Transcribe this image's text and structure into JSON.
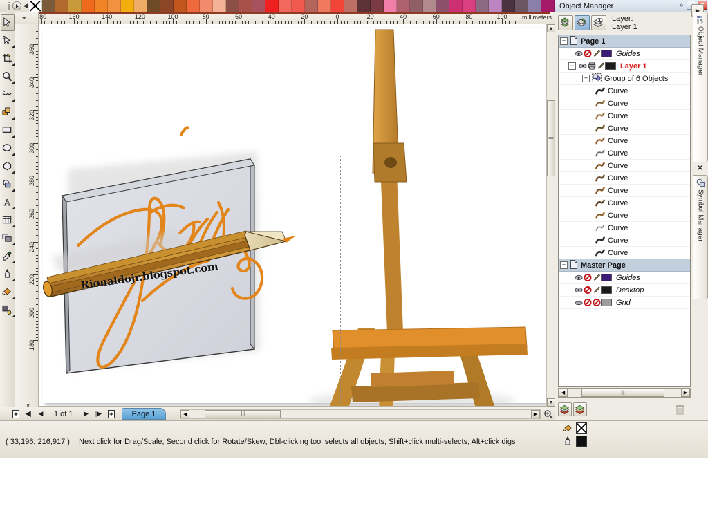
{
  "app": {
    "palette": {
      "name": "color-palette",
      "no_color_label": "No Color",
      "swatches": [
        "#7a5c3a",
        "#b06a2c",
        "#c89a3a",
        "#ef6a1d",
        "#f08325",
        "#f2913f",
        "#f4ad0e",
        "#eeac67",
        "#6e4a26",
        "#8c4526",
        "#c2571d",
        "#ee6a3c",
        "#f08b6c",
        "#f3b195",
        "#8a4f47",
        "#a8504a",
        "#a8525f",
        "#ef2020",
        "#f2685c",
        "#f05a4f",
        "#b3665c",
        "#f07a5e",
        "#f2453a",
        "#bc7065",
        "#5d3237",
        "#7b3b45",
        "#ef7fa8",
        "#b0616f",
        "#8e6066",
        "#b08a8c",
        "#8c4f6c",
        "#cc2f72",
        "#d8407f",
        "#8c6a84",
        "#bd84c2",
        "#4a3240",
        "#6b5663",
        "#8a7fa8",
        "#a61a6a",
        "#8e5a7e",
        "#7a5390",
        "#6d4f86"
      ],
      "current_color": "#101010"
    },
    "toolbox": [
      {
        "name": "pick-tool",
        "label": "Pick",
        "active": true,
        "flyout": false
      },
      {
        "name": "shape-tool",
        "label": "Shape",
        "active": false,
        "flyout": true
      },
      {
        "name": "crop-tool",
        "label": "Crop",
        "active": false,
        "flyout": true
      },
      {
        "name": "zoom-tool",
        "label": "Zoom",
        "active": false,
        "flyout": true
      },
      {
        "name": "freehand-tool",
        "label": "Freehand",
        "active": false,
        "flyout": true
      },
      {
        "name": "smart-fill-tool",
        "label": "Smart Fill",
        "active": false,
        "flyout": true
      },
      {
        "name": "rectangle-tool",
        "label": "Rectangle",
        "active": false,
        "flyout": true
      },
      {
        "name": "ellipse-tool",
        "label": "Ellipse",
        "active": false,
        "flyout": true
      },
      {
        "name": "polygon-tool",
        "label": "Polygon",
        "active": false,
        "flyout": true
      },
      {
        "name": "basic-shapes-tool",
        "label": "Basic Shapes",
        "active": false,
        "flyout": true
      },
      {
        "name": "text-tool",
        "label": "Text",
        "active": false,
        "flyout": true
      },
      {
        "name": "table-tool",
        "label": "Table",
        "active": false,
        "flyout": true
      },
      {
        "name": "blend-tool",
        "label": "Blend",
        "active": false,
        "flyout": true
      },
      {
        "name": "eyedropper-tool",
        "label": "Color Eyedropper",
        "active": false,
        "flyout": true
      },
      {
        "name": "outline-tool",
        "label": "Outline",
        "active": false,
        "flyout": true
      },
      {
        "name": "fill-tool",
        "label": "Fill",
        "active": false,
        "flyout": true
      },
      {
        "name": "interactive-fill-tool",
        "label": "Interactive Fill",
        "active": false,
        "flyout": true
      }
    ],
    "rulers": {
      "unit_label": "millimeters",
      "horizontal_ticks": [
        140,
        120,
        100,
        80,
        60,
        40,
        20,
        0,
        20,
        40,
        60,
        80
      ],
      "vertical_ticks": [
        360,
        340,
        320,
        300,
        280,
        260,
        240,
        220,
        200
      ]
    },
    "canvas": {
      "watermark": "Rionaldojr.blogspot.com",
      "artwork_description": "easel-with-canvas-and-pencil"
    },
    "pagenav": {
      "add_page_before_label": "+",
      "first_label": "◀|",
      "prev_label": "◀",
      "counter": "1 of 1",
      "next_label": "▶",
      "last_label": "|▶",
      "add_page_after_label": "+",
      "tab_label": "Page 1"
    },
    "docker": {
      "title": "Object Manager",
      "chevron_label": "»",
      "minimize_label": "–",
      "close_label": "✕",
      "layer_caption_line1": "Layer:",
      "layer_caption_line2": "Layer 1",
      "buttons": [
        {
          "name": "show-object-properties-button",
          "label": "Show Object Properties",
          "on": false
        },
        {
          "name": "edit-across-layers-button",
          "label": "Edit Across Layers",
          "on": true
        },
        {
          "name": "layer-manager-view-button",
          "label": "Layer Manager View",
          "on": false
        }
      ],
      "options_label": "▶",
      "tree": [
        {
          "name": "page-1-row",
          "label": "Page 1",
          "type": "header",
          "expander": "−",
          "indent": 2,
          "icon": "page-icon",
          "style": "bold"
        },
        {
          "name": "guides-row",
          "label": "Guides",
          "type": "item",
          "indent": 22,
          "icon": "eye-printer-pencil",
          "color": "#3c1c78",
          "style": "italic",
          "locked": true
        },
        {
          "name": "layer-1-row",
          "label": "Layer 1",
          "type": "item",
          "expander": "−",
          "indent": 14,
          "icon": "eye-printer-pencil",
          "color": "#1b1b1b",
          "style": "red"
        },
        {
          "name": "group-row",
          "label": "Group of 6 Objects",
          "type": "group",
          "expander": "+",
          "indent": 34,
          "icon": "group-icon"
        },
        {
          "name": "curve-row",
          "label": "Curve",
          "type": "curve",
          "indent": 52,
          "icon_color": "#2b2b2b"
        },
        {
          "name": "curve-row",
          "label": "Curve",
          "type": "curve",
          "indent": 52,
          "icon_color": "#b08a52"
        },
        {
          "name": "curve-row",
          "label": "Curve",
          "type": "curve",
          "indent": 52,
          "icon_color": "#c9a06a"
        },
        {
          "name": "curve-row",
          "label": "Curve",
          "type": "curve",
          "indent": 52,
          "icon_color": "#8a6a3c"
        },
        {
          "name": "curve-row",
          "label": "Curve",
          "type": "curve",
          "indent": 52,
          "icon_color": "#c08a5c"
        },
        {
          "name": "curve-row",
          "label": "Curve",
          "type": "curve",
          "indent": 52,
          "icon_color": "#a8a2a8"
        },
        {
          "name": "curve-row",
          "label": "Curve",
          "type": "curve",
          "indent": 52,
          "icon_color": "#a06a34"
        },
        {
          "name": "curve-row",
          "label": "Curve",
          "type": "curve",
          "indent": 52,
          "icon_color": "#8a6640"
        },
        {
          "name": "curve-row",
          "label": "Curve",
          "type": "curve",
          "indent": 52,
          "icon_color": "#b07a40"
        },
        {
          "name": "curve-row",
          "label": "Curve",
          "type": "curve",
          "indent": 52,
          "icon_color": "#7a5a34"
        },
        {
          "name": "curve-row",
          "label": "Curve",
          "type": "curve",
          "indent": 52,
          "icon_color": "#c08840"
        },
        {
          "name": "curve-row",
          "label": "Curve",
          "type": "curve",
          "indent": 52,
          "icon_color": "#d8d4d8"
        },
        {
          "name": "curve-row",
          "label": "Curve",
          "type": "curve",
          "indent": 52,
          "icon_color": "#2b2b2b"
        },
        {
          "name": "curve-row",
          "label": "Curve",
          "type": "curve",
          "indent": 52,
          "icon_color": "#2b2b2b"
        },
        {
          "name": "master-page-row",
          "label": "Master Page",
          "type": "header",
          "expander": "−",
          "indent": 2,
          "icon": "page-icon",
          "style": "bold"
        },
        {
          "name": "master-guides-row",
          "label": "Guides",
          "type": "item",
          "indent": 22,
          "icon": "eye-printer-pencil",
          "color": "#3c1c78",
          "style": "italic",
          "locked": true
        },
        {
          "name": "master-desktop-row",
          "label": "Desktop",
          "type": "item",
          "indent": 22,
          "icon": "eye-printer-pencil",
          "color": "#1b1b1b",
          "style": "italic",
          "locked": true
        },
        {
          "name": "master-grid-row",
          "label": "Grid",
          "type": "item",
          "indent": 22,
          "icon": "eye-lock-lock",
          "color": "#9d9d9d",
          "style": "italic",
          "locked": true
        }
      ],
      "bottom_buttons": [
        {
          "name": "new-layer-button",
          "label": "New Layer"
        },
        {
          "name": "new-master-layer-button",
          "label": "New Master Layer"
        }
      ],
      "delete_label": "Delete",
      "tabs": [
        {
          "name": "docker-tab-object-manager",
          "label": "Object Manager",
          "active": true
        },
        {
          "name": "docker-tab-symbol-manager",
          "label": "Symbol Manager",
          "active": false
        }
      ],
      "tab_close_label": "✕"
    },
    "statusbar": {
      "coords": "( 33,196; 216,917 )",
      "hint": "Next click for Drag/Scale; Second click for Rotate/Skew; Dbl-clicking tool selects all objects; Shift+click multi-selects; Alt+click digs",
      "fill_label": "No Fill",
      "outline_label": "Black",
      "outline_color": "#101010"
    }
  }
}
